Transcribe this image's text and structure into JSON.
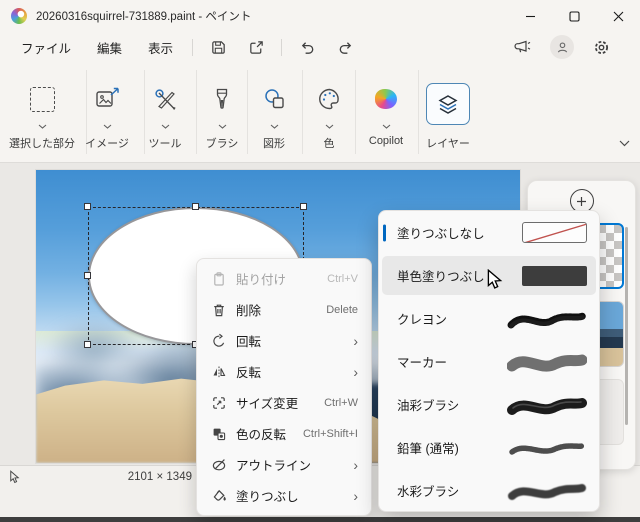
{
  "window": {
    "title": "20260316squirrel-731889.paint - ペイント",
    "app_icon": "paint-app-icon",
    "controls": {
      "minimize": "minimize",
      "maximize": "maximize",
      "close": "close"
    }
  },
  "menubar": {
    "menus": [
      {
        "label": "ファイル"
      },
      {
        "label": "編集"
      },
      {
        "label": "表示"
      }
    ],
    "quick_actions": [
      "save-icon",
      "share-icon",
      "undo-icon",
      "redo-icon"
    ],
    "right_actions": [
      "feedback-icon",
      "account-icon",
      "settings-icon"
    ]
  },
  "toolbar": {
    "groups": [
      {
        "label": "選択した部分",
        "icon": "selection-icon",
        "has_dropdown": true
      },
      {
        "label": "イメージ",
        "icon": "image-icon",
        "has_dropdown": true
      },
      {
        "label": "ツール",
        "icon": "tools-icon",
        "has_dropdown": true
      },
      {
        "label": "ブラシ",
        "icon": "brush-icon",
        "has_dropdown": true
      },
      {
        "label": "図形",
        "icon": "shapes-icon",
        "has_dropdown": true
      },
      {
        "label": "色",
        "icon": "color-palette-icon",
        "has_dropdown": true
      },
      {
        "label": "Copilot",
        "icon": "copilot-icon",
        "has_dropdown": true
      },
      {
        "label": "レイヤー",
        "icon": "layers-icon",
        "has_dropdown": false,
        "active": true
      }
    ],
    "overflow_icon": "chevron-down-icon"
  },
  "context_menu": {
    "submenu_arrow": "›",
    "items": [
      {
        "label": "貼り付け",
        "shortcut": "Ctrl+V",
        "icon": "paste-icon",
        "disabled": true
      },
      {
        "label": "削除",
        "shortcut": "Delete",
        "icon": "delete-icon"
      },
      {
        "label": "回転",
        "icon": "rotate-icon",
        "submenu": true
      },
      {
        "label": "反転",
        "icon": "flip-icon",
        "submenu": true
      },
      {
        "label": "サイズ変更",
        "shortcut": "Ctrl+W",
        "icon": "resize-icon"
      },
      {
        "label": "色の反転",
        "shortcut": "Ctrl+Shift+I",
        "icon": "invert-colors-icon"
      },
      {
        "label": "アウトライン",
        "icon": "outline-icon",
        "submenu": true
      },
      {
        "label": "塗りつぶし",
        "icon": "fill-icon",
        "submenu": true
      }
    ]
  },
  "fill_submenu": {
    "items": [
      {
        "label": "塗りつぶしなし",
        "preview": "no-fill",
        "selected": true
      },
      {
        "label": "単色塗りつぶし",
        "preview": "solid",
        "hovered": true
      },
      {
        "label": "クレヨン",
        "preview": "crayon"
      },
      {
        "label": "マーカー",
        "preview": "marker"
      },
      {
        "label": "油彩ブラシ",
        "preview": "oil-brush"
      },
      {
        "label": "鉛筆 (通常)",
        "preview": "pencil"
      },
      {
        "label": "水彩ブラシ",
        "preview": "watercolor"
      }
    ]
  },
  "layers_panel": {
    "add_icon": "add-layer-icon"
  },
  "status_bar": {
    "image_dimensions": "2101 × 1349",
    "cursor_icon": "cursor-position-icon"
  },
  "colors": {
    "accent": "#0067c0",
    "layer_selected_border": "#0078d4",
    "no_fill_line": "#c0524e",
    "hover_bg": "#e8e8e8"
  }
}
